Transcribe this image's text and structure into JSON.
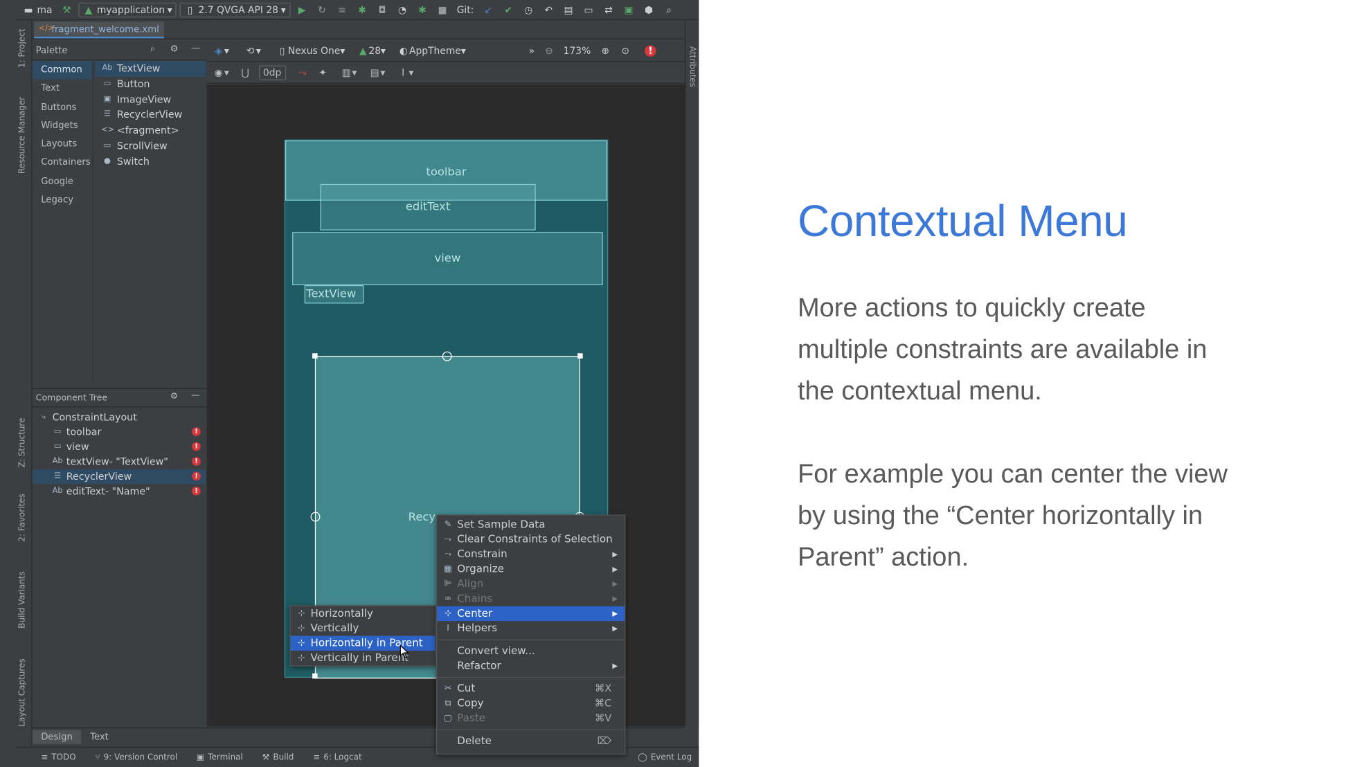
{
  "toolbar": {
    "project": "ma",
    "run_config": "myapplication",
    "device": "2.7  QVGA API 28",
    "git_label": "Git:"
  },
  "left_tool_windows": [
    "1: Project",
    "Resource Manager",
    "Z: Structure",
    "2: Favorites",
    "Build Variants",
    "Layout Captures"
  ],
  "right_tool_windows": [
    "Attributes"
  ],
  "editor": {
    "file_tab": "fragment_welcome.xml"
  },
  "palette": {
    "title": "Palette",
    "categories": [
      "Common",
      "Text",
      "Buttons",
      "Widgets",
      "Layouts",
      "Containers",
      "Google",
      "Legacy"
    ],
    "selected_category": "Common",
    "items": [
      {
        "icon": "Ab",
        "label": "TextView"
      },
      {
        "icon": "▭",
        "label": "Button"
      },
      {
        "icon": "▣",
        "label": "ImageView"
      },
      {
        "icon": "☰",
        "label": "RecyclerView"
      },
      {
        "icon": "<>",
        "label": "<fragment>"
      },
      {
        "icon": "▭",
        "label": "ScrollView"
      },
      {
        "icon": "●",
        "label": "Switch"
      }
    ]
  },
  "design_toolbar": {
    "device": "Nexus One",
    "api": "28",
    "theme": "AppTheme",
    "zoom": "173%",
    "margin": "0dp"
  },
  "component_tree": {
    "title": "Component Tree",
    "rows": [
      {
        "icon": "⤷",
        "label": "ConstraintLayout",
        "error": false,
        "selected": false
      },
      {
        "icon": "▭",
        "label": "toolbar",
        "error": true,
        "selected": false
      },
      {
        "icon": "▭",
        "label": "view",
        "error": true,
        "selected": false
      },
      {
        "icon": "Ab",
        "label": "textView- \"TextView\"",
        "error": true,
        "selected": false
      },
      {
        "icon": "☰",
        "label": "RecyclerView",
        "error": true,
        "selected": true
      },
      {
        "icon": "Ab",
        "label": "editText- \"Name\"",
        "error": true,
        "selected": false
      }
    ]
  },
  "canvas": {
    "toolbar_label": "toolbar",
    "edittext_label": "editText",
    "view_label": "view",
    "textview_label": "TextView",
    "recycler_label": "Recy"
  },
  "context_menu": {
    "items": [
      {
        "icon": "✎",
        "label": "Set Sample Data",
        "shortcut": "",
        "submenu": false,
        "disabled": false,
        "selected": false
      },
      {
        "icon": "⤳",
        "label": "Clear Constraints of Selection",
        "shortcut": "",
        "submenu": false,
        "disabled": false,
        "selected": false
      },
      {
        "icon": "⤳",
        "label": "Constrain",
        "shortcut": "",
        "submenu": true,
        "disabled": false,
        "selected": false
      },
      {
        "icon": "▦",
        "label": "Organize",
        "shortcut": "",
        "submenu": true,
        "disabled": false,
        "selected": false
      },
      {
        "icon": "⊫",
        "label": "Align",
        "shortcut": "",
        "submenu": true,
        "disabled": true,
        "selected": false
      },
      {
        "icon": "∞",
        "label": "Chains",
        "shortcut": "",
        "submenu": true,
        "disabled": true,
        "selected": false
      },
      {
        "icon": "⊹",
        "label": "Center",
        "shortcut": "",
        "submenu": true,
        "disabled": false,
        "selected": true
      },
      {
        "icon": "I",
        "label": "Helpers",
        "shortcut": "",
        "submenu": true,
        "disabled": false,
        "selected": false
      },
      {
        "sep": true
      },
      {
        "icon": "",
        "label": "Convert view...",
        "shortcut": "",
        "submenu": false,
        "disabled": false,
        "selected": false
      },
      {
        "icon": "",
        "label": "Refactor",
        "shortcut": "",
        "submenu": true,
        "disabled": false,
        "selected": false
      },
      {
        "sep": true
      },
      {
        "icon": "✂",
        "label": "Cut",
        "shortcut": "⌘X",
        "submenu": false,
        "disabled": false,
        "selected": false
      },
      {
        "icon": "⧉",
        "label": "Copy",
        "shortcut": "⌘C",
        "submenu": false,
        "disabled": false,
        "selected": false
      },
      {
        "icon": "▢",
        "label": "Paste",
        "shortcut": "⌘V",
        "submenu": false,
        "disabled": true,
        "selected": false
      },
      {
        "sep": true
      },
      {
        "icon": "",
        "label": "Delete",
        "shortcut": "⌦",
        "submenu": false,
        "disabled": false,
        "selected": false
      }
    ]
  },
  "center_submenu": {
    "items": [
      {
        "icon": "⊹",
        "label": "Horizontally",
        "selected": false
      },
      {
        "icon": "⊹",
        "label": "Vertically",
        "selected": false
      },
      {
        "icon": "⊹",
        "label": "Horizontally in Parent",
        "selected": true
      },
      {
        "icon": "⊹",
        "label": "Vertically in Parent",
        "selected": false
      }
    ]
  },
  "editor_tabs": [
    "Design",
    "Text"
  ],
  "status_bar": [
    "TODO",
    "9: Version Control",
    "Terminal",
    "Build",
    "6: Logcat",
    "Event Log"
  ],
  "slide": {
    "title": "Contextual Menu",
    "paragraph1": "More actions to quickly create multiple constraints are available in the contextual menu.",
    "paragraph2": "For example you can center the view by using the “Center horizontally in Parent” action."
  },
  "colors": {
    "title_blue": "#3c78d8",
    "body_text": "#595959",
    "menu_selection": "#2c62c6",
    "canvas_teal": "#1f5b62"
  }
}
